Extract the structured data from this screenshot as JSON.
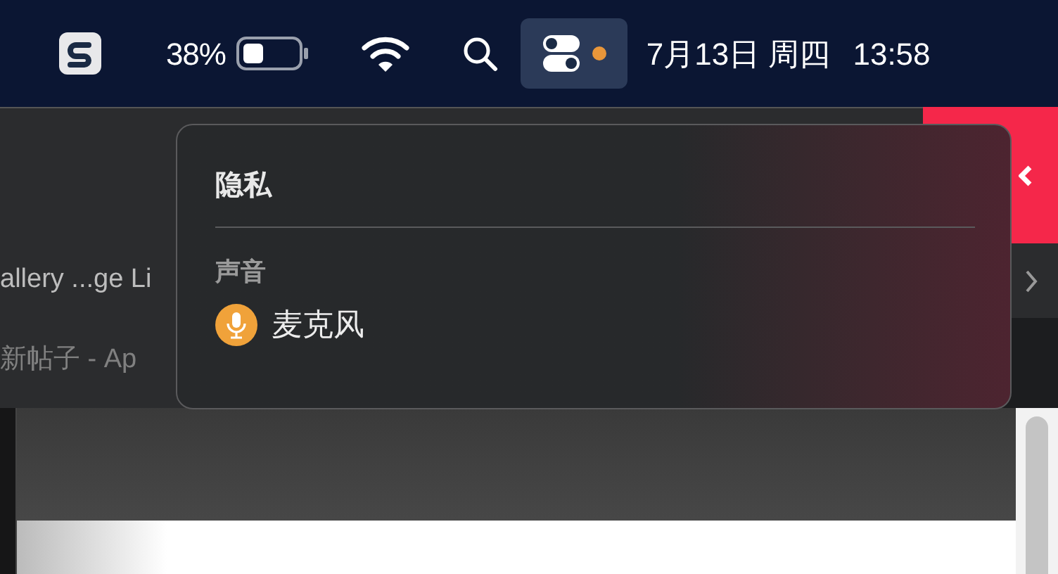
{
  "menu_bar": {
    "battery_percent": "38%",
    "control_center": {
      "selected": true,
      "recording": true
    },
    "date": "7月13日 周四",
    "time": "13:58"
  },
  "background_window": {
    "tab_texts": [
      "allery ...ge Li",
      "新帖子 - Ap"
    ]
  },
  "privacy_popover": {
    "title": "隐私",
    "sections": [
      {
        "heading": "声音",
        "items": [
          {
            "label": "麦克风",
            "kind": "microphone"
          }
        ]
      }
    ]
  }
}
